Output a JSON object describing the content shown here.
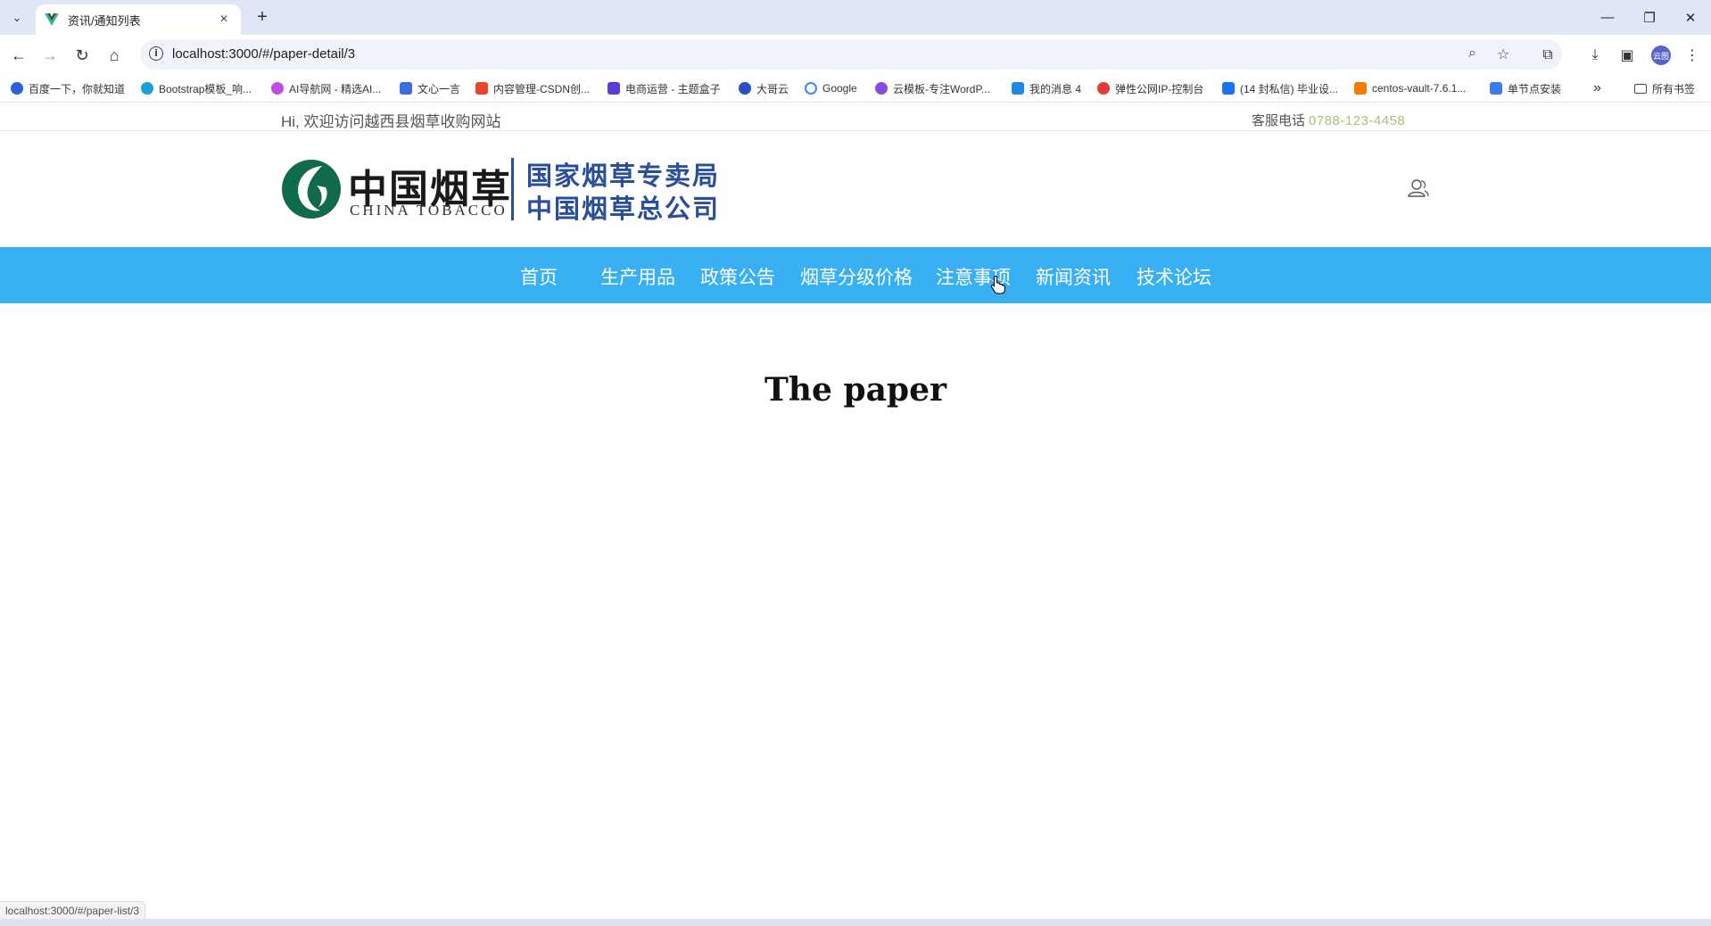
{
  "browser": {
    "tab_title": "资讯/通知列表",
    "url": "localhost:3000/#/paper-detail/3",
    "avatar_label": "云图",
    "status_url": "localhost:3000/#/paper-list/3"
  },
  "bookmarks": [
    {
      "label": "百度一下，你就知道",
      "color": "#2f60d8"
    },
    {
      "label": "Bootstrap模板_响...",
      "color": "#1aa0d8"
    },
    {
      "label": "AI导航网 - 精选AI...",
      "color": "#c24de0"
    },
    {
      "label": "文心一言",
      "color": "#3b6de0"
    },
    {
      "label": "内容管理-CSDN创...",
      "color": "#e8452c"
    },
    {
      "label": "电商运营 - 主题盒子",
      "color": "#5b3bd6"
    },
    {
      "label": "大哥云",
      "color": "#2a4fc4"
    },
    {
      "label": "Google",
      "color": "#4285f4"
    },
    {
      "label": "云模板-专注WordP...",
      "color": "#8a4ce0"
    },
    {
      "label": "我的消息 4",
      "color": "#1e88e5"
    },
    {
      "label": "弹性公网IP-控制台",
      "color": "#e53935"
    },
    {
      "label": "(14 封私信) 毕业设...",
      "color": "#1772f6"
    },
    {
      "label": "centos-vault-7.6.1...",
      "color": "#f57c00"
    },
    {
      "label": "单节点安装",
      "color": "#3d7be8"
    }
  ],
  "bookmarks_more": "»",
  "bookmarks_folder": "所有书签",
  "site": {
    "welcome": "Hi, 欢迎访问越西县烟草收购网站",
    "hotline_label": "客服电话",
    "hotline_number": "0788-123-4458",
    "logo": {
      "cn": "中国烟草",
      "en": "CHINA TOBACCO",
      "right_line1": "国家烟草专卖局",
      "right_line2": "中国烟草总公司"
    },
    "nav": [
      "首页",
      "生产用品",
      "政策公告",
      "烟草分级价格",
      "注意事项",
      "新闻资讯",
      "技术论坛"
    ],
    "content_title": "The paper"
  },
  "colors": {
    "nav_bg": "#39b0f4",
    "hotline": "#a7c07a",
    "logo_green": "#0f6b4a",
    "logo_blue": "#2a4f9a"
  }
}
